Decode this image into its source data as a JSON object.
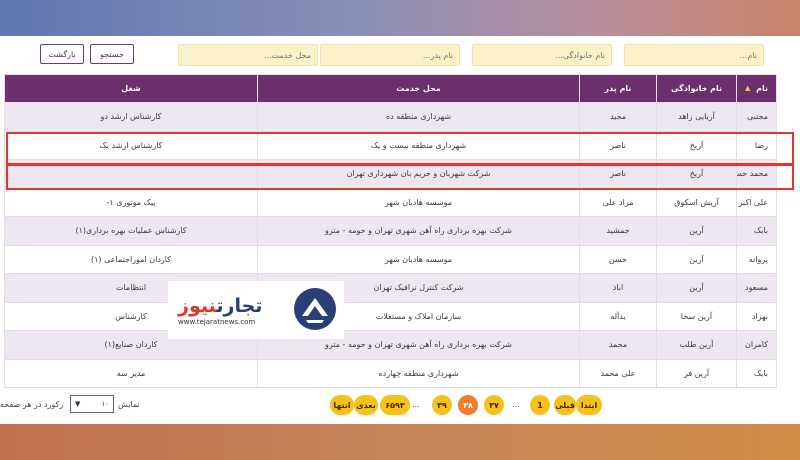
{
  "filters": {
    "name_placeholder": "نام...",
    "family_placeholder": "نام خانوادگی...",
    "father_placeholder": "نام پدر...",
    "workplace_placeholder": "محل خدمت...",
    "search_label": "جستجو",
    "back_label": "بازگشت"
  },
  "table": {
    "headers": [
      "نام",
      "نام خانوادگی",
      "نام پدر",
      "محل خدمت",
      "شغل"
    ],
    "rows": [
      [
        "مجتبی",
        "آریایی زاهد",
        "مجید",
        "شهرداری منطقه ده",
        "کارشناس ارشد دو"
      ],
      [
        "رضا",
        "آریخ",
        "ناصر",
        "شهرداری منطقه بیست و یک",
        "کارشناس ارشد یک"
      ],
      [
        "محمد حسین",
        "آریخ",
        "ناصر",
        "شرکت شهربان و حریم بان شهرداری تهران",
        ""
      ],
      [
        "علی اکبر",
        "آریش اسکوق",
        "مراد علی",
        "موسسه هادیان شهر",
        "پیک موتوری ۱-"
      ],
      [
        "بابک",
        "آرین",
        "جمشید",
        "شرکت بهره برداری راه آهن شهری تهران و حومه - مترو",
        "کارشناس عملیات بهره برداری(۱)"
      ],
      [
        "پروانه",
        "آرین",
        "حسن",
        "موسسه هادیان شهر",
        "کاردان اموراجتماعی (۱)"
      ],
      [
        "مسعود",
        "آرین",
        "اباذ",
        "شرکت کنترل ترافیک تهران",
        "انتظامات"
      ],
      [
        "بهزاد",
        "آرین سخا",
        "یدآله",
        "سازمان املاک و مستغلات",
        "کارشناس"
      ],
      [
        "کامران",
        "آرین طلب",
        "محمد",
        "شرکت بهره برداری راه آهن شهری تهران و حومه - مترو",
        "کاردان صنایع(۱)"
      ],
      [
        "بابک",
        "آرین فر",
        "علی محمد",
        "شهرداری منطقه چهارده",
        "مدیر سه"
      ]
    ]
  },
  "pagination": {
    "first": "ابتدا",
    "prev": "قبلی",
    "p1": "1",
    "dots": "...",
    "p37": "۳۷",
    "p38": "۳۸",
    "p39": "۳۹",
    "p6593": "۶۵۹۳",
    "next": "بعدی",
    "last": "انتها",
    "show_label": "نمایش",
    "per_page_value": "۱۰",
    "per_page_suffix": "رکورد در هر صفحه"
  },
  "watermark": {
    "brand_part1": "تجارت",
    "brand_part2": "نیوز",
    "url": "www.tejaratnews.com"
  },
  "colors": {
    "header_purple": "#6b2f6e",
    "page_yellow": "#f6c21a",
    "page_active": "#f07b2a",
    "highlight_red": "#e53528"
  }
}
